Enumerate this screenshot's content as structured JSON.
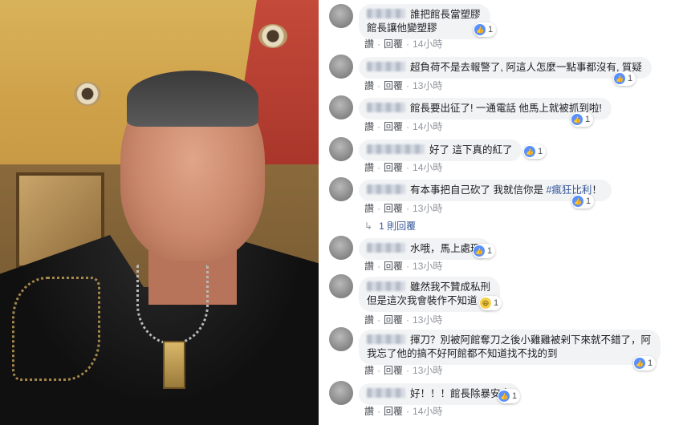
{
  "comments": [
    {
      "lines": [
        "誰把館長當塑膠",
        "館長讓他變塑膠"
      ],
      "action_like": "讚",
      "action_reply": "回覆",
      "time": "14小時",
      "reactions": "1",
      "reaction_icon": "like-icon"
    },
    {
      "lines": [
        "超負荷不是去報警了, 阿這人怎麼一點事都沒有, 質疑"
      ],
      "action_like": "讚",
      "action_reply": "回覆",
      "time": "13小時",
      "reactions": "1",
      "reaction_icon": "like-icon"
    },
    {
      "lines": [
        "館長要出征了! 一通電話 他馬上就被抓到啦!"
      ],
      "action_like": "讚",
      "action_reply": "回覆",
      "time": "14小時",
      "reactions": "1",
      "reaction_icon": "like-icon"
    },
    {
      "lines": [
        "好了 這下真的紅了"
      ],
      "action_like": "讚",
      "action_reply": "回覆",
      "time": "14小時",
      "reactions": "1",
      "reaction_icon": "like-icon"
    },
    {
      "lines_prefix": "有本事把自己砍了 我就信你是 ",
      "hashtag": "#瘋狂比利",
      "lines_suffix": "！",
      "action_like": "讚",
      "action_reply": "回覆",
      "time": "13小時",
      "reactions": "1",
      "reaction_icon": "like-icon",
      "replies_link": "1 則回覆"
    },
    {
      "lines": [
        "水哦，馬上處理"
      ],
      "action_like": "讚",
      "action_reply": "回覆",
      "time": "13小時",
      "reactions": "1",
      "reaction_icon": "like-icon"
    },
    {
      "lines": [
        "雖然我不贊成私刑",
        "但是這次我會裝作不知道"
      ],
      "action_like": "讚",
      "action_reply": "回覆",
      "time": "13小時",
      "reactions": "1",
      "reaction_icon": "haha-icon"
    },
    {
      "lines": [
        "揮刀？別被阿館奪刀之後小雞雞被剁下來就不錯了，阿",
        "我忘了他的搞不好阿館都不知道找不找的到"
      ],
      "action_like": "讚",
      "action_reply": "回覆",
      "time": "13小時",
      "reactions": "1",
      "reaction_icon": "like-icon"
    },
    {
      "lines": [
        "好！！！館長除暴安良"
      ],
      "action_like": "讚",
      "action_reply": "回覆",
      "time": "14小時",
      "reactions": "1",
      "reaction_icon": "like-icon"
    }
  ],
  "colors": {
    "bubble_bg": "#f2f3f5",
    "link_blue": "#365899",
    "like_blue": "#5890ff",
    "meta_gray": "#90949c"
  }
}
